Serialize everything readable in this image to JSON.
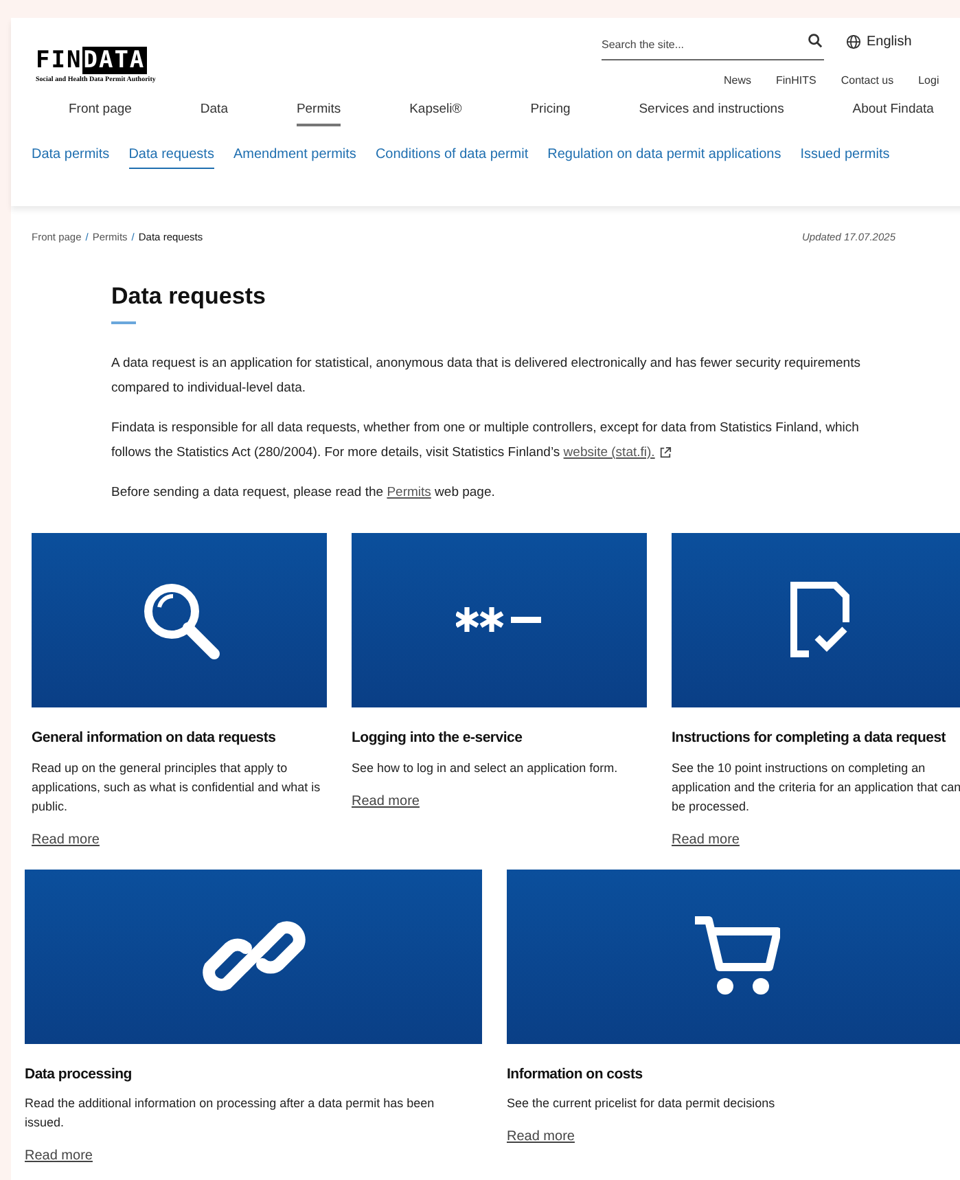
{
  "logo": {
    "plain": "FIN",
    "inverted": "DATA",
    "tagline": "Social and Health Data Permit Authority"
  },
  "search": {
    "placeholder": "Search the site..."
  },
  "language": "English",
  "utility_links": [
    "News",
    "FinHITS",
    "Contact us",
    "Logi"
  ],
  "main_nav": [
    {
      "label": "Front page",
      "selected": false
    },
    {
      "label": "Data",
      "selected": false
    },
    {
      "label": "Permits",
      "selected": true
    },
    {
      "label": "Kapseli®",
      "selected": false
    },
    {
      "label": "Pricing",
      "selected": false
    },
    {
      "label": "Services and instructions",
      "selected": false
    },
    {
      "label": "About Findata",
      "selected": false
    }
  ],
  "sub_nav": [
    {
      "label": "Data permits",
      "selected": false
    },
    {
      "label": "Data requests",
      "selected": true
    },
    {
      "label": "Amendment permits",
      "selected": false
    },
    {
      "label": "Conditions of data permit",
      "selected": false
    },
    {
      "label": "Regulation on data permit applications",
      "selected": false
    },
    {
      "label": "Issued permits",
      "selected": false
    }
  ],
  "breadcrumb": [
    {
      "kind": "link",
      "text": "Front page"
    },
    {
      "kind": "separator",
      "text": "/"
    },
    {
      "kind": "link",
      "text": "Permits"
    },
    {
      "kind": "separator",
      "text": "/"
    },
    {
      "kind": "current",
      "text": "Data requests"
    }
  ],
  "updated": "Updated 17.07.2025",
  "title": "Data requests",
  "paragraphs": [
    [
      {
        "kind": "text",
        "text": "A data request is an application for statistical, anonymous data that is delivered electronically and has fewer security requirements compared to individual-level data."
      }
    ],
    [
      {
        "kind": "text",
        "text": "Findata is responsible for all data requests, whether from one or multiple controllers, except for data from Statistics Finland, which follows the Statistics Act (280/2004). For more details, visit Statistics Finland’s "
      },
      {
        "kind": "external_link",
        "text": "website (stat.fi)."
      }
    ],
    [
      {
        "kind": "text",
        "text": "Before sending a data request, please read the "
      },
      {
        "kind": "link",
        "text": "Permits"
      },
      {
        "kind": "text",
        "text": " web page."
      }
    ]
  ],
  "card_rows": [
    [
      {
        "kind": "search",
        "title": "General information on data requests",
        "description": "Read up on the general principles that apply to applications, such as what is confidential and what is public.",
        "link": "Read more"
      },
      {
        "kind": "password",
        "title": "Logging into the e-service",
        "description": "See how to log in and select an application form.",
        "link": "Read more"
      },
      {
        "kind": "document-check",
        "title": "Instructions for completing a data request",
        "description": "See the 10 point instructions on completing an application and the criteria for an application that can be processed.",
        "link": "Read more"
      }
    ],
    [
      {
        "kind": "link",
        "title": "Data processing",
        "description": "Read the additional information on processing after a data permit has been issued.",
        "link": "Read more"
      },
      {
        "kind": "cart",
        "title": "Information on costs",
        "description": "See the current pricelist for data permit decisions",
        "link": "Read more"
      }
    ]
  ]
}
